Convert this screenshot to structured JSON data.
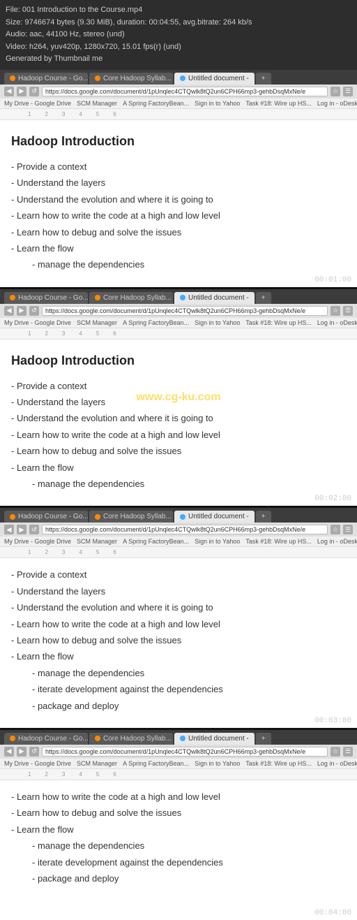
{
  "file_info": {
    "line1": "File: 001 Introduction to the Course.mp4",
    "line2": "Size: 9746674 bytes (9.30 MiB), duration: 00:04:55, avg.bitrate: 264 kb/s",
    "line3": "Audio: aac, 44100 Hz, stereo (und)",
    "line4": "Video: h264, yuv420p, 1280x720, 15.01 fps(r) (und)",
    "line5": "Generated by Thumbnail me"
  },
  "browser": {
    "tabs": [
      {
        "label": "Hadoop Course - Go...",
        "icon_color": "orange",
        "active": false
      },
      {
        "label": "Core Hadoop Syllab...",
        "icon_color": "orange",
        "active": false
      },
      {
        "label": "Untitled document -",
        "icon_color": "blue",
        "active": true
      },
      {
        "label": "+",
        "icon_color": "",
        "active": false
      }
    ],
    "address": "https://docs.google.com/document/d/1pUnqlec4CTQwlk8tQ2un6CPH66mp3-gehbDsqMxNe/e",
    "bookmarks": [
      "My Drive - Google Drive",
      "SCM Manager",
      "A Spring FactoryBean...",
      "Sign in to Yahoo",
      "Task #18: Wire up HS...",
      "Log in - oDesk"
    ]
  },
  "panels": [
    {
      "id": "panel1",
      "timestamp": "00:01:00",
      "has_watermark": false,
      "title": "Hadoop Introduction",
      "cursor_after_title": false,
      "cursor_line": 0,
      "items": [
        {
          "text": "- Provide a context",
          "indent": 0
        },
        {
          "text": "- Understand the layers",
          "indent": 0
        },
        {
          "text": "- Understand the evolution and where it is going to",
          "indent": 0
        },
        {
          "text": "- Learn how to write the code at a high and low level",
          "indent": 0
        },
        {
          "text": "- Learn how to debug and solve the issues",
          "indent": 0
        },
        {
          "text": "- Learn the flow",
          "indent": 0
        },
        {
          "text": "- manage the dependencies",
          "indent": 1
        }
      ]
    },
    {
      "id": "panel2",
      "timestamp": "00:02:00",
      "has_watermark": true,
      "watermark_text": "www.cg-ku.com",
      "title": "Hadoop Introduction",
      "cursor_after_title": false,
      "cursor_line": 1,
      "items": [
        {
          "text": "- Provide a context",
          "indent": 0
        },
        {
          "text": "- Understand the layers",
          "indent": 0
        },
        {
          "text": "- Understand the evolution and where it is going to",
          "indent": 0
        },
        {
          "text": "- Learn how to write the code at a high and low level",
          "indent": 0
        },
        {
          "text": "- Learn how to debug and solve the issues",
          "indent": 0
        },
        {
          "text": "- Learn the flow",
          "indent": 0
        },
        {
          "text": "- manage the dependencies",
          "indent": 1
        }
      ]
    },
    {
      "id": "panel3",
      "timestamp": "00:03:00",
      "has_watermark": false,
      "title": null,
      "items": [
        {
          "text": "- Provide a context",
          "indent": 0
        },
        {
          "text": "- Understand the layers",
          "indent": 0
        },
        {
          "text": "- Understand the evolution and where it is going to",
          "indent": 0
        },
        {
          "text": "- Learn how to write the code at a high and low level",
          "indent": 0
        },
        {
          "text": "- Learn how to debug and solve the issues",
          "indent": 0
        },
        {
          "text": "- Learn the flow",
          "indent": 0
        },
        {
          "text": "- manage the dependencies",
          "indent": 1
        },
        {
          "text": "- iterate development against the dependencies",
          "indent": 1
        },
        {
          "text": "- package and deploy",
          "indent": 1
        }
      ]
    },
    {
      "id": "panel4",
      "timestamp": "00:04:00",
      "has_watermark": false,
      "title": null,
      "items": [
        {
          "text": "- Learn how to write the code at a high and low level",
          "indent": 0
        },
        {
          "text": "- Learn how to debug and solve the issues",
          "indent": 0
        },
        {
          "text": "- Learn the flow",
          "indent": 0
        },
        {
          "text": "- manage the dependencies",
          "indent": 1
        },
        {
          "text": "- iterate development against the dependencies",
          "indent": 1
        },
        {
          "text": "- package and deploy",
          "indent": 1
        }
      ]
    }
  ],
  "ruler_marks": [
    "1",
    "2",
    "3",
    "4",
    "5",
    "6"
  ]
}
